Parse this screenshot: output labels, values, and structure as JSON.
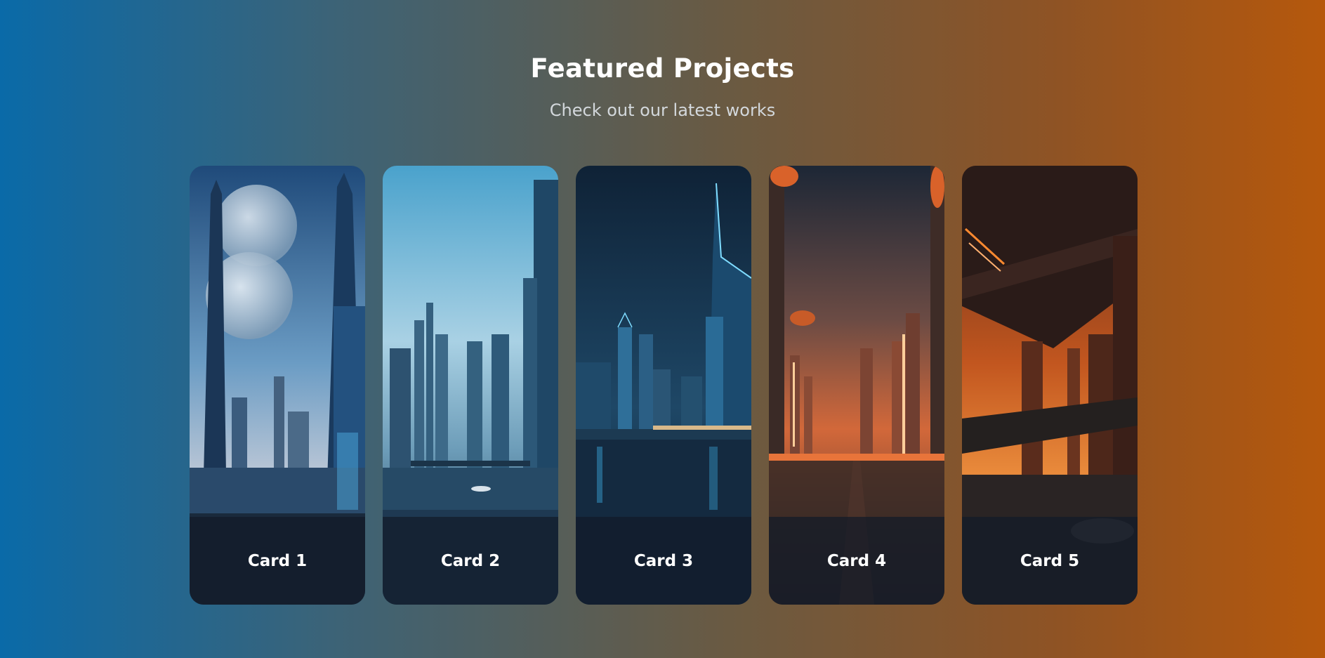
{
  "header": {
    "title": "Featured Projects",
    "subtitle": "Check out our latest works"
  },
  "cards": [
    {
      "label": "Card 1",
      "scene": "futuristic city with twin moons, blue tones",
      "accent": "#4fb3e8"
    },
    {
      "label": "Card 2",
      "scene": "skyscraper skyline over river, daylight blue",
      "accent": "#7ec8e6"
    },
    {
      "label": "Card 3",
      "scene": "neon blue city reflected in water at night",
      "accent": "#3fb6f0"
    },
    {
      "label": "Card 4",
      "scene": "orange glowing city street with airships",
      "accent": "#ff7a2e"
    },
    {
      "label": "Card 5",
      "scene": "orange sci-fi megastructure city",
      "accent": "#ff8a30"
    }
  ]
}
